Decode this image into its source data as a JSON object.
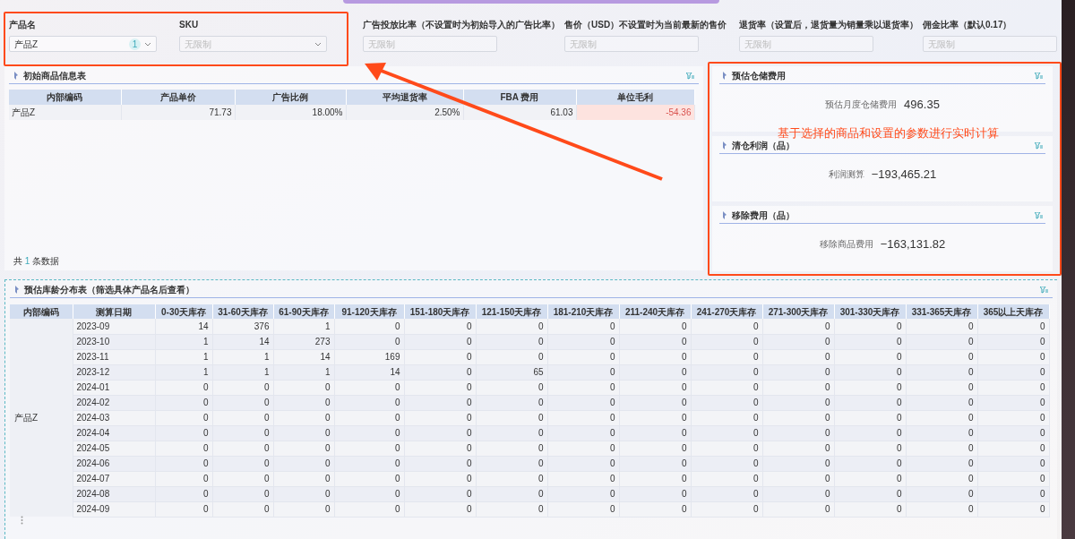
{
  "filters": [
    {
      "label": "产品名",
      "kind": "select",
      "value": "产品Z",
      "badge": "1"
    },
    {
      "label": "SKU",
      "kind": "select",
      "placeholder": "无限制"
    },
    {
      "label": "广告投放比率（不设置时为初始导入的广告比率）",
      "kind": "input",
      "placeholder": "无限制"
    },
    {
      "label": "售价（USD）不设置时为当前最新的售价",
      "kind": "input",
      "placeholder": "无限制"
    },
    {
      "label": "退货率（设置后，退货量为销量乘以退货率）",
      "kind": "input",
      "placeholder": "无限制"
    },
    {
      "label": "佣金比率（默认0.17）",
      "kind": "input",
      "placeholder": "无限制"
    }
  ],
  "product_table": {
    "title": "初始商品信息表",
    "columns": [
      "内部编码",
      "产品单价",
      "广告比例",
      "平均退货率",
      "FBA 费用",
      "单位毛利"
    ],
    "rows": [
      [
        {
          "text": "产品Z",
          "highlighted": false
        },
        {
          "text": "71.73",
          "highlighted": false
        },
        {
          "text": "18.00%",
          "highlighted": false
        },
        {
          "text": "2.50%",
          "highlighted": false
        },
        {
          "text": "61.03",
          "highlighted": false
        },
        {
          "text": "-54.36",
          "highlighted": true
        }
      ]
    ],
    "footer": {
      "prefix": "共",
      "count": "1",
      "suffix": "条数据"
    }
  },
  "metric_cards": [
    {
      "title": "预估仓储费用",
      "label": "预估月度仓储费用",
      "value": "496.35"
    },
    {
      "title": "清仓利润（品）",
      "label": "利润测算",
      "value": "−193,465.21"
    },
    {
      "title": "移除费用（品）",
      "label": "移除商品费用",
      "value": "−163,131.82"
    }
  ],
  "annotation": "基于选择的商品和设置的参数进行实时计算",
  "age_table": {
    "title": "预估库龄分布表（筛选具体产品名后查看）",
    "columns": [
      "内部编码",
      "测算日期",
      "0-30天库存",
      "31-60天库存",
      "61-90天库存",
      "91-120天库存",
      "151-180天库存",
      "121-150天库存",
      "181-210天库存",
      "211-240天库存",
      "241-270天库存",
      "271-300天库存",
      "301-330天库存",
      "331-365天库存",
      "365以上天库存"
    ],
    "rows": [
      [
        "",
        "2023-09",
        "14",
        "376",
        "1",
        "0",
        "0",
        "0",
        "0",
        "0",
        "0",
        "0",
        "0",
        "0",
        "0"
      ],
      [
        "",
        "2023-10",
        "1",
        "14",
        "273",
        "0",
        "0",
        "0",
        "0",
        "0",
        "0",
        "0",
        "0",
        "0",
        "0"
      ],
      [
        "",
        "2023-11",
        "1",
        "1",
        "14",
        "169",
        "0",
        "0",
        "0",
        "0",
        "0",
        "0",
        "0",
        "0",
        "0"
      ],
      [
        "",
        "2023-12",
        "1",
        "1",
        "1",
        "14",
        "0",
        "65",
        "0",
        "0",
        "0",
        "0",
        "0",
        "0",
        "0"
      ],
      [
        "",
        "2024-01",
        "0",
        "0",
        "0",
        "0",
        "0",
        "0",
        "0",
        "0",
        "0",
        "0",
        "0",
        "0",
        "0"
      ],
      [
        "",
        "2024-02",
        "0",
        "0",
        "0",
        "0",
        "0",
        "0",
        "0",
        "0",
        "0",
        "0",
        "0",
        "0",
        "0"
      ],
      [
        "产品Z",
        "2024-03",
        "0",
        "0",
        "0",
        "0",
        "0",
        "0",
        "0",
        "0",
        "0",
        "0",
        "0",
        "0",
        "0"
      ],
      [
        "",
        "2024-04",
        "0",
        "0",
        "0",
        "0",
        "0",
        "0",
        "0",
        "0",
        "0",
        "0",
        "0",
        "0",
        "0"
      ],
      [
        "",
        "2024-05",
        "0",
        "0",
        "0",
        "0",
        "0",
        "0",
        "0",
        "0",
        "0",
        "0",
        "0",
        "0",
        "0"
      ],
      [
        "",
        "2024-06",
        "0",
        "0",
        "0",
        "0",
        "0",
        "0",
        "0",
        "0",
        "0",
        "0",
        "0",
        "0",
        "0"
      ],
      [
        "",
        "2024-07",
        "0",
        "0",
        "0",
        "0",
        "0",
        "0",
        "0",
        "0",
        "0",
        "0",
        "0",
        "0",
        "0"
      ],
      [
        "",
        "2024-08",
        "0",
        "0",
        "0",
        "0",
        "0",
        "0",
        "0",
        "0",
        "0",
        "0",
        "0",
        "0",
        "0"
      ],
      [
        "",
        "2024-09",
        "0",
        "0",
        "0",
        "0",
        "0",
        "0",
        "0",
        "0",
        "0",
        "0",
        "0",
        "0",
        "0"
      ]
    ]
  }
}
